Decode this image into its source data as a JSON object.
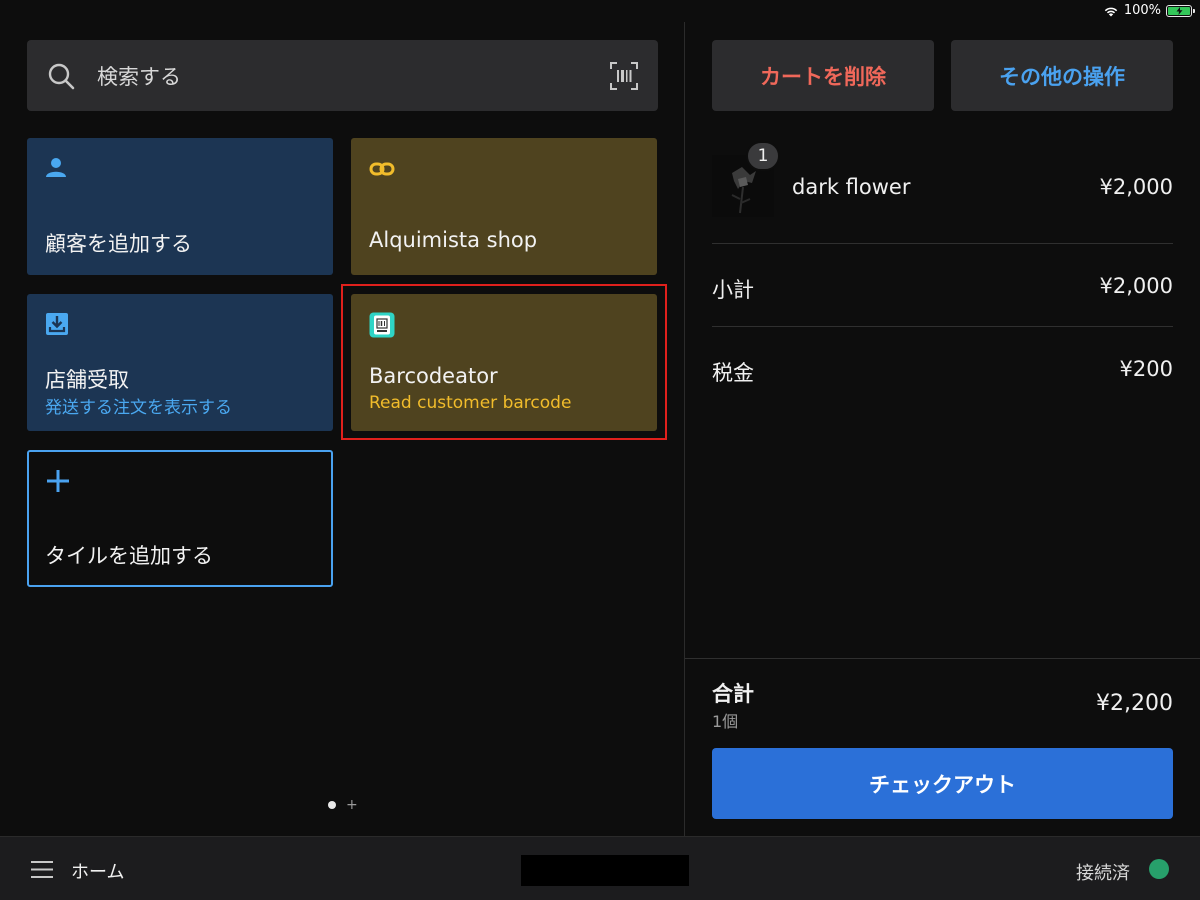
{
  "status_bar": {
    "battery_label": "100%",
    "icons": [
      "wifi-icon",
      "battery-charging-icon"
    ]
  },
  "search": {
    "placeholder": "検索する",
    "icons": [
      "search-icon",
      "barcode-scan-icon"
    ]
  },
  "tiles": [
    {
      "title": "顧客を追加する",
      "icon": "person-icon",
      "color": "#1c3553"
    },
    {
      "title": "Alquimista shop",
      "icon": "link-icon",
      "color": "#4f431f"
    },
    {
      "title": "店舗受取",
      "subtitle": "発送する注文を表示する",
      "icon": "download-tray-icon",
      "color": "#1c3553"
    },
    {
      "title": "Barcodeator",
      "subtitle": "Read customer barcode",
      "icon": "barcode-app-icon",
      "color": "#4f431f",
      "highlighted": true
    },
    {
      "title": "タイルを追加する",
      "icon": "plus-icon",
      "color": "#4aa2f0"
    }
  ],
  "cart": {
    "delete_label": "カートを削除",
    "more_label": "その他の操作",
    "items": [
      {
        "name": "dark flower",
        "price": "¥2,000",
        "qty": "1",
        "thumbnail": "dark-flower-thumbnail"
      }
    ],
    "subtotal_label": "小計",
    "subtotal_value": "¥2,000",
    "tax_label": "税金",
    "tax_value": "¥200",
    "total_label": "合計",
    "total_count": "1個",
    "total_value": "¥2,200",
    "checkout_label": "チェックアウト"
  },
  "bottom_bar": {
    "home_label": "ホーム",
    "connection_label": "接続済",
    "connection_color": "#27a06b"
  },
  "accent": {
    "primary": "#2b70d8",
    "danger": "#f0685a",
    "link": "#4aa2f0"
  }
}
